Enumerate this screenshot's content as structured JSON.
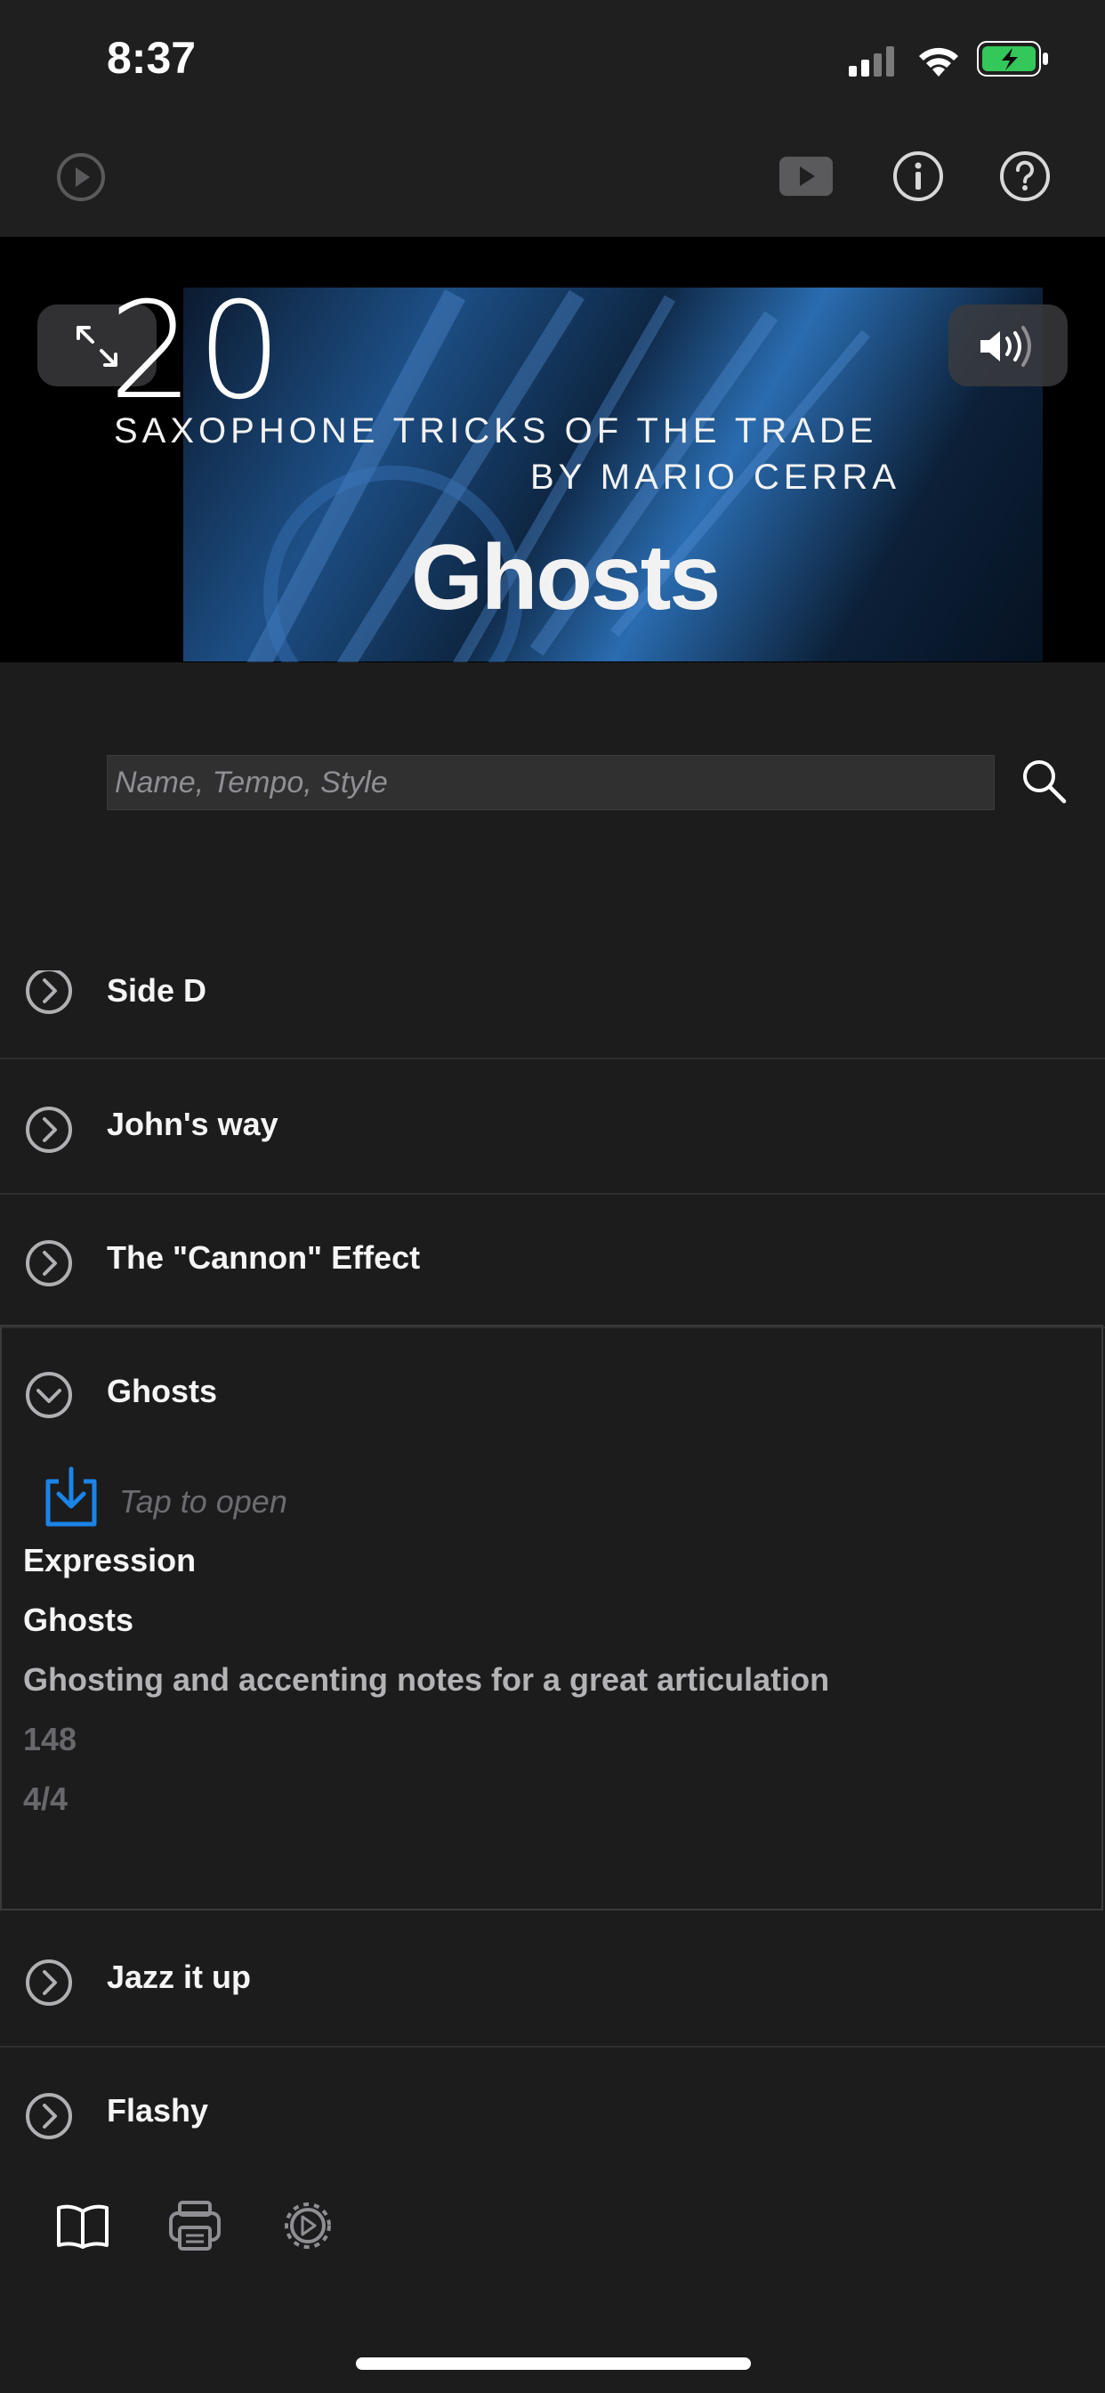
{
  "status_bar": {
    "time": "8:37"
  },
  "toolbar": {
    "play_icon": "play-circle-icon",
    "video_icon": "video-play-icon",
    "info_icon": "info-icon",
    "help_icon": "help-icon"
  },
  "video": {
    "number": "20",
    "subtitle_line1": "SAXOPHONE TRICKS OF THE TRADE",
    "subtitle_line2": "BY MARIO CERRA",
    "title": "Ghosts",
    "expand_icon": "expand-icon",
    "volume_icon": "volume-icon"
  },
  "search": {
    "placeholder": "Name, Tempo, Style",
    "value": ""
  },
  "list": {
    "items": [
      {
        "label": "Side D"
      },
      {
        "label": "John's way"
      },
      {
        "label": "The \"Cannon\" Effect"
      },
      {
        "label": "Ghosts"
      },
      {
        "label": "Jazz it up"
      },
      {
        "label": "Flashy"
      }
    ],
    "expanded": {
      "open_hint": "Tap to open",
      "category": "Expression",
      "name": "Ghosts",
      "description": "Ghosting and accenting notes for a great articulation",
      "tempo": "148",
      "time_signature": "4/4"
    }
  },
  "tabbar": {
    "items": [
      "book-icon",
      "printer-icon",
      "settings-icon"
    ]
  },
  "colors": {
    "accent": "#1a84e8",
    "background": "#1c1c1d",
    "bar": "#1f1f1f"
  }
}
